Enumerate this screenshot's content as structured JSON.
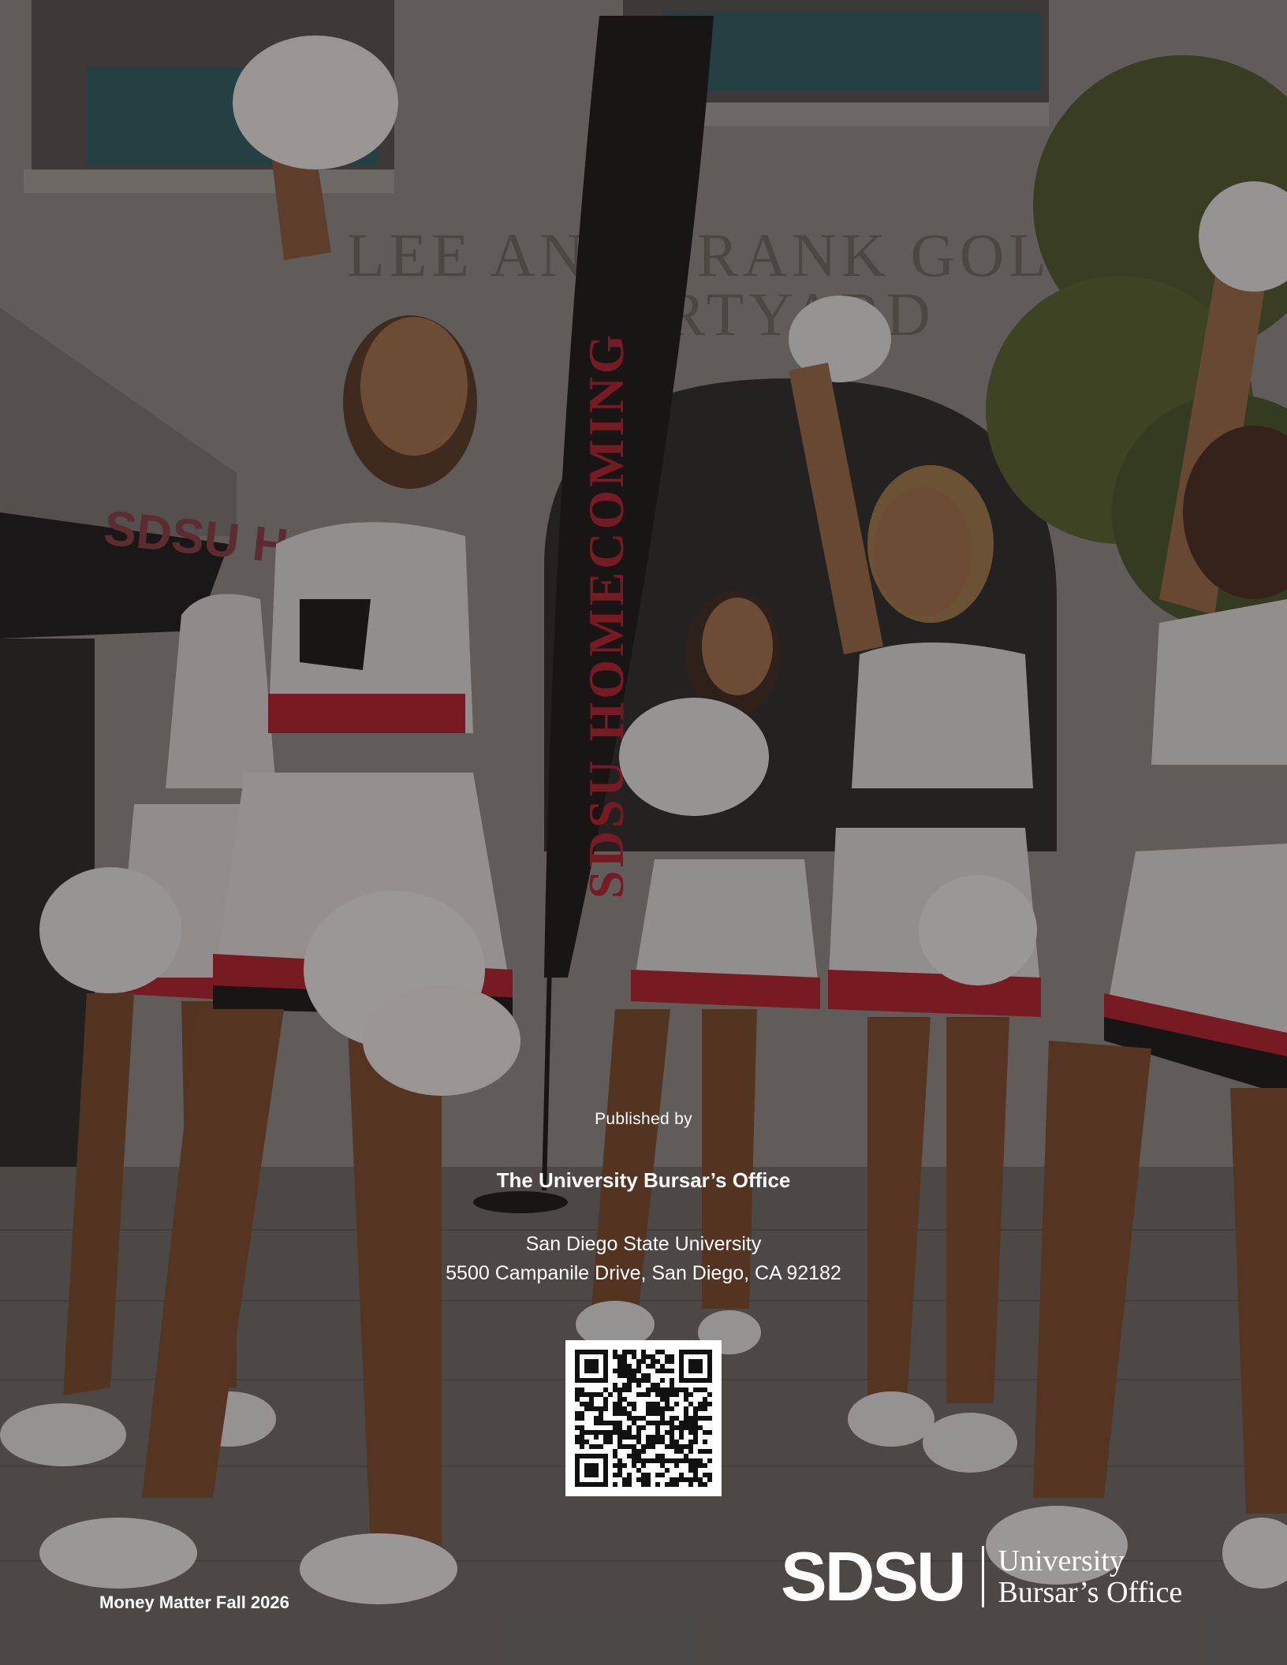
{
  "photo": {
    "description_icon": "cheerleaders-photo",
    "banner_text": "SDSU HOMECOMING",
    "building_text_line1": "LEE AND FRANK GOL",
    "building_text_line2": "URTYARD",
    "tent_text": "SDSU H"
  },
  "colophon": {
    "published_by": "Published by",
    "office_name": "The University Bursar’s Office",
    "address_line1": "San Diego State University",
    "address_line2": "5500 Campanile Drive, San Diego, CA 92182"
  },
  "qr": {
    "icon": "qr-code-icon"
  },
  "footer": {
    "issue": "Money Matter Fall 2026",
    "logo_mark": "SDSU",
    "logo_line1": "University",
    "logo_line2": "Bursar’s Office"
  },
  "colors": {
    "accent_red": "#c8102e",
    "text": "#ffffff"
  }
}
